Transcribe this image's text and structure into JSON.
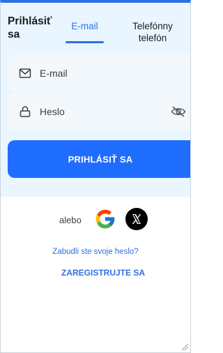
{
  "header": {
    "title": "Prihlásiť sa"
  },
  "tabs": [
    {
      "label": "E-mail",
      "active": true
    },
    {
      "label": "Telefónny telefón",
      "active": false
    }
  ],
  "form": {
    "email_placeholder": "E-mail",
    "password_placeholder": "Heslo",
    "submit_label": "PRIHLÁSIŤ SA"
  },
  "social": {
    "or_label": "alebo",
    "providers": [
      "google-icon",
      "x-icon"
    ]
  },
  "links": {
    "forgot_password": "Zabudli ste svoje heslo?",
    "register": "ZAREGISTRUJTE SA"
  },
  "colors": {
    "accent": "#2f6fe4",
    "button": "#1f6dff",
    "panel": "#e9f6ff",
    "field": "#f3f8fc"
  },
  "icons": [
    "mail-icon",
    "lock-icon",
    "eye-off-icon",
    "google-icon",
    "x-icon",
    "resize-handle-icon"
  ]
}
